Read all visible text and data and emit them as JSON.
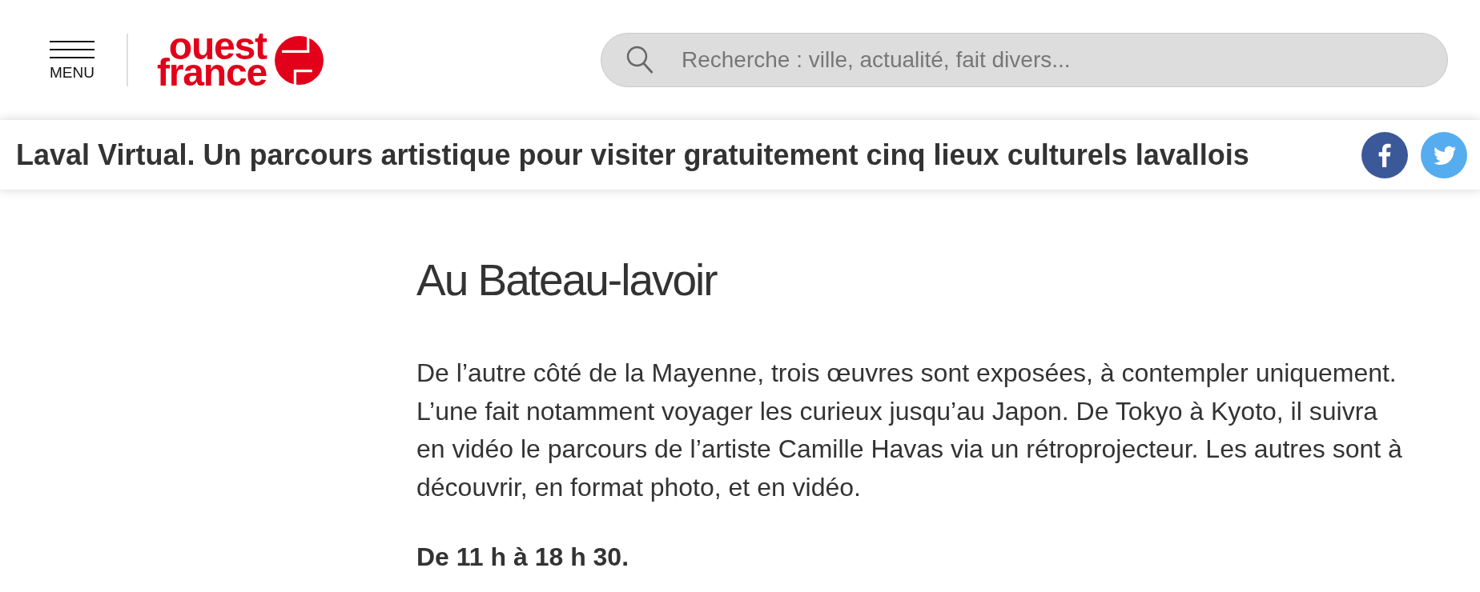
{
  "header": {
    "menu_label": "MENU",
    "logo": {
      "line_1": "ouest",
      "line_2": "france"
    },
    "search": {
      "placeholder": "Recherche : ville, actualité, fait divers..."
    }
  },
  "title_bar": {
    "title": "Laval Virtual. Un parcours artistique pour visiter gratuitement cinq lieux culturels lavallois",
    "share": [
      {
        "kind": "letter",
        "color": "#3b5998"
      },
      {
        "kind": "bird",
        "color": "#55acee"
      }
    ]
  },
  "content": {
    "heading": "Au Bateau-lavoir",
    "paragraphs": [
      {
        "text": "De l’autre côté de la Mayenne, trois œuvres sont exposées, à contempler uniquement. L’une fait notamment voyager les curieux jusqu’au Japon. De Tokyo à Kyoto, il suivra en vidéo le parcours de l’artiste Camille Havas via un rétroprojecteur. Les autres sont à découvrir, en format photo, et en vidéo.",
        "bold": false
      },
      {
        "text": "De 11 h à 18 h 30.",
        "bold": true
      }
    ]
  }
}
